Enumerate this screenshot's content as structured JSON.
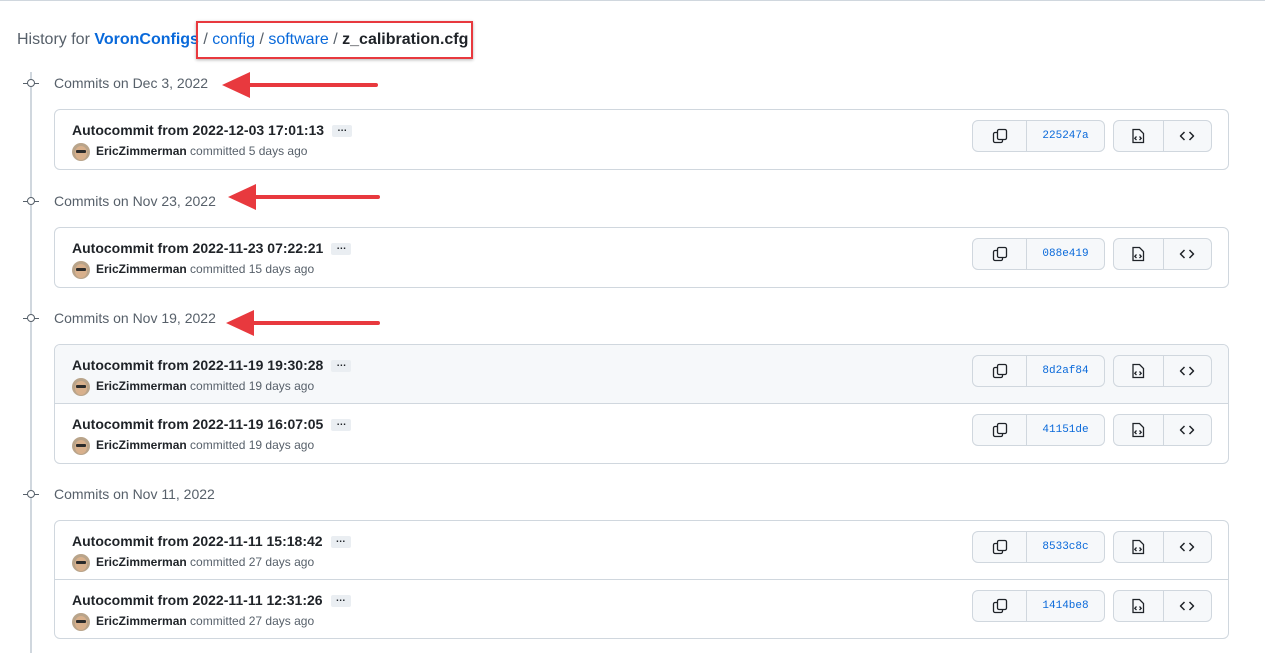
{
  "breadcrumb": {
    "prefix": "History for",
    "repo": "VoronConfigs",
    "path": [
      "config",
      "software"
    ],
    "file": "z_calibration.cfg"
  },
  "accent_colors": {
    "link": "#0969da",
    "annotation": "#e8393e",
    "border": "#d0d7de"
  },
  "groups": [
    {
      "title": "Commits on Dec 3, 2022",
      "commits": [
        {
          "message": "Autocommit from 2022-12-03 17:01:13",
          "author": "EricZimmerman",
          "meta": "committed 5 days ago",
          "sha": "225247a"
        }
      ]
    },
    {
      "title": "Commits on Nov 23, 2022",
      "commits": [
        {
          "message": "Autocommit from 2022-11-23 07:22:21",
          "author": "EricZimmerman",
          "meta": "committed 15 days ago",
          "sha": "088e419"
        }
      ]
    },
    {
      "title": "Commits on Nov 19, 2022",
      "commits": [
        {
          "message": "Autocommit from 2022-11-19 19:30:28",
          "author": "EricZimmerman",
          "meta": "committed 19 days ago",
          "sha": "8d2af84"
        },
        {
          "message": "Autocommit from 2022-11-19 16:07:05",
          "author": "EricZimmerman",
          "meta": "committed 19 days ago",
          "sha": "41151de"
        }
      ]
    },
    {
      "title": "Commits on Nov 11, 2022",
      "commits": [
        {
          "message": "Autocommit from 2022-11-11 15:18:42",
          "author": "EricZimmerman",
          "meta": "committed 27 days ago",
          "sha": "8533c8c"
        },
        {
          "message": "Autocommit from 2022-11-11 12:31:26",
          "author": "EricZimmerman",
          "meta": "committed 27 days ago",
          "sha": "1414be8"
        }
      ]
    }
  ],
  "ellipsis_label": "…",
  "icons": [
    "copy-icon",
    "file-code-icon",
    "code-icon",
    "git-commit-icon",
    "red-arrow-annotation"
  ]
}
